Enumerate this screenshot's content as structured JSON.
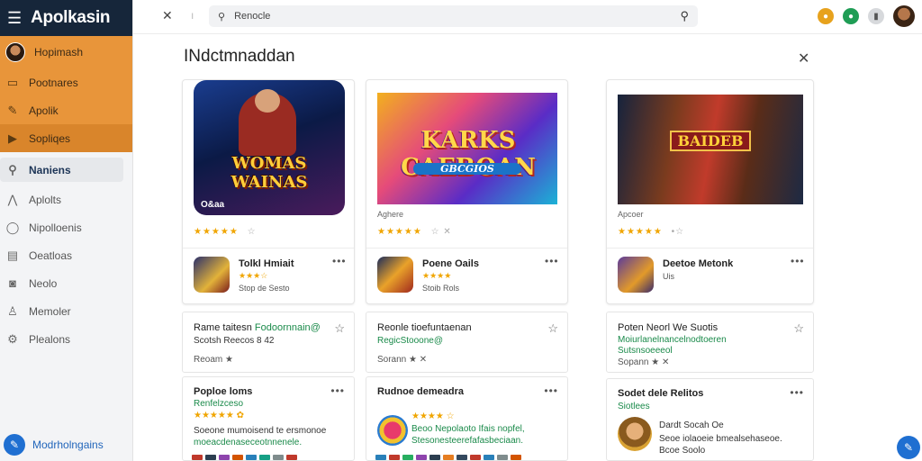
{
  "app": {
    "title": "Apolkasin"
  },
  "sidebar": {
    "user": "Hopimash",
    "highlight_items": [
      {
        "label": "Pootnares",
        "icon": "folder-icon"
      },
      {
        "label": "Apolik",
        "icon": "pencil-icon"
      },
      {
        "label": "Sopliqes",
        "icon": "tag-icon"
      }
    ],
    "items": [
      {
        "label": "Naniens",
        "icon": "search-icon"
      },
      {
        "label": "Aplolts",
        "icon": "mountain-icon"
      },
      {
        "label": "Nipolloenis",
        "icon": "bubble-icon"
      },
      {
        "label": "Oeatloas",
        "icon": "list-icon"
      },
      {
        "label": "Neolo",
        "icon": "gamepad-icon"
      },
      {
        "label": "Memoler",
        "icon": "person-icon"
      },
      {
        "label": "Plealons",
        "icon": "gear-icon"
      }
    ],
    "bottom_label": "Modrholngains"
  },
  "topbar": {
    "search_value": "Renocle"
  },
  "main": {
    "title": "INdctmnaddan",
    "heroes": [
      {
        "image_title": "WOMAS WAINAS",
        "image_caption": "O&aa",
        "subtitle": "",
        "stars": "★★★★★",
        "stars_extra": "☆",
        "app_name": "Tolkl Hmiait",
        "app_rating": "★★★☆",
        "app_extra": "Stop de Sesto"
      },
      {
        "image_title": "KARKS CAEBOAN",
        "image_sub": "GBCGIOS",
        "subtitle": "Aghere",
        "stars": "★★★★★",
        "stars_extra": "☆ ✕",
        "app_name": "Poene Oails",
        "app_rating": "★★★★",
        "app_extra": "Stoib Rols"
      },
      {
        "image_title": "BAIDEB",
        "subtitle": "Apcoer",
        "stars": "★★★★★",
        "stars_extra": "•☆",
        "app_name": "Deetoe Metonk",
        "app_rating": "",
        "app_extra": "Uis"
      }
    ],
    "lists": [
      {
        "title": "Rame taitesn",
        "title_green": "Fodoornnain@",
        "line2": "Scotsh Reecos 8 42",
        "foot": "Reoam ★"
      },
      {
        "title": "Reonle tioefuntaenan",
        "line2": "RegicStooone@",
        "foot": "Sorann ★ ✕"
      },
      {
        "title": "Poten Neorl We Suotis",
        "line2a": "Moiurlanelnancelnodtoeren",
        "line2b": "Sutsnsoeeeol",
        "foot": "Sopann ★ ✕"
      },
      {
        "title": "Poploe loms",
        "green": "Renfelzceso",
        "stars": "★★★★★ ✿",
        "t1": "Soeone mumoisend te ersmonoe",
        "t2": "moeacdenaseceotnnenele."
      },
      {
        "title": "Rudnoe demeadra",
        "stars": "★★★★ ☆",
        "t1": "Beoo Nepolaoto Ifais nopfel,",
        "t2": "Stesonesteerefafasbeciaan."
      },
      {
        "title": "Sodet dele Relitos",
        "green": "Siotlees",
        "t1": "Dardt Socah Oe",
        "t2": "Seoe iolaoeie bmealsehaseoe.",
        "t3": "Bcoe Soolo"
      }
    ]
  }
}
